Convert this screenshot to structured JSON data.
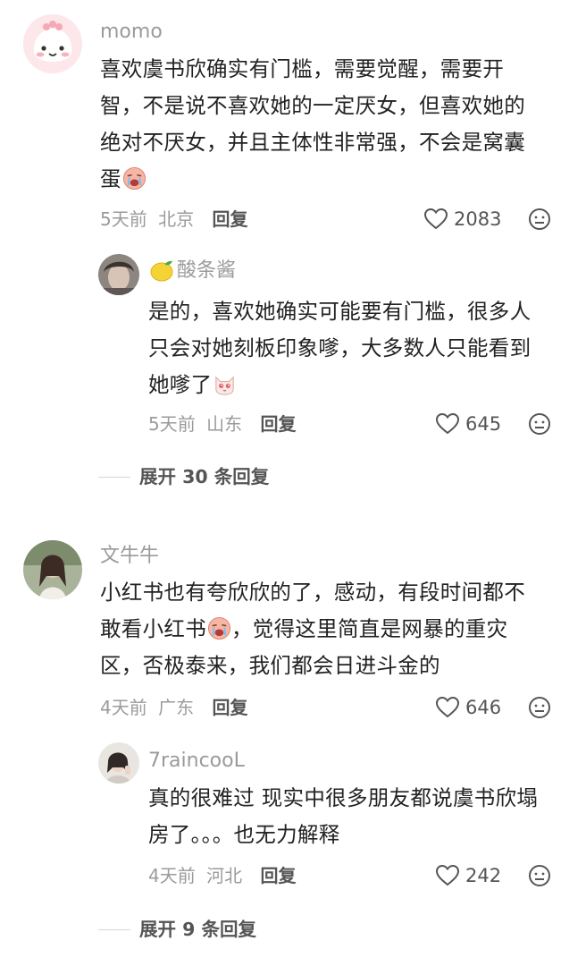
{
  "comments": [
    {
      "author": "momo",
      "lines": [
        "喜欢虞书欣确实有门槛，需要觉醒，需要开",
        "智，不是说不喜欢她的一定厌女，但喜欢她的",
        "绝对不厌女，并且主体性非常强，不会是窝囊",
        "蛋"
      ],
      "emoji": "crying-face-emoji",
      "time": "5天前",
      "location": "北京",
      "reply_label": "回复",
      "likes": "2083",
      "replies": [
        {
          "author": "酸条酱",
          "author_emoji": "lemon-emoji",
          "lines": [
            "是的，喜欢她确实可能要有门槛，很多人",
            "只会对她刻板印象嗲，大多数人只能看到",
            "她嗲了"
          ],
          "emoji": "cat-face-emoji",
          "time": "5天前",
          "location": "山东",
          "reply_label": "回复",
          "likes": "645"
        }
      ],
      "expand_label": "展开 30 条回复"
    },
    {
      "author": "文牛牛",
      "lines": [
        "小红书也有夸欣欣的了，感动，有段时间都不",
        "敢看小红书",
        "区，否极泰来，我们都会日进斗金的"
      ],
      "line2_tail": "，觉得这里简直是网暴的重灾",
      "emoji": "crying-face-emoji",
      "time": "4天前",
      "location": "广东",
      "reply_label": "回复",
      "likes": "646",
      "replies": [
        {
          "author": "7raincooL",
          "lines": [
            "真的很难过 现实中很多朋友都说虞书欣塌",
            "房了。。。也无力解释"
          ],
          "time": "4天前",
          "location": "河北",
          "reply_label": "回复",
          "likes": "242"
        }
      ],
      "expand_label": "展开 9 条回复"
    }
  ],
  "icons": {
    "like": "heart-outline-icon",
    "dislike": "neutral-face-icon"
  },
  "colors": {
    "author": "#9a9a9a",
    "body": "#222222",
    "meta": "#9b9b9b",
    "reply_action": "#555555"
  }
}
